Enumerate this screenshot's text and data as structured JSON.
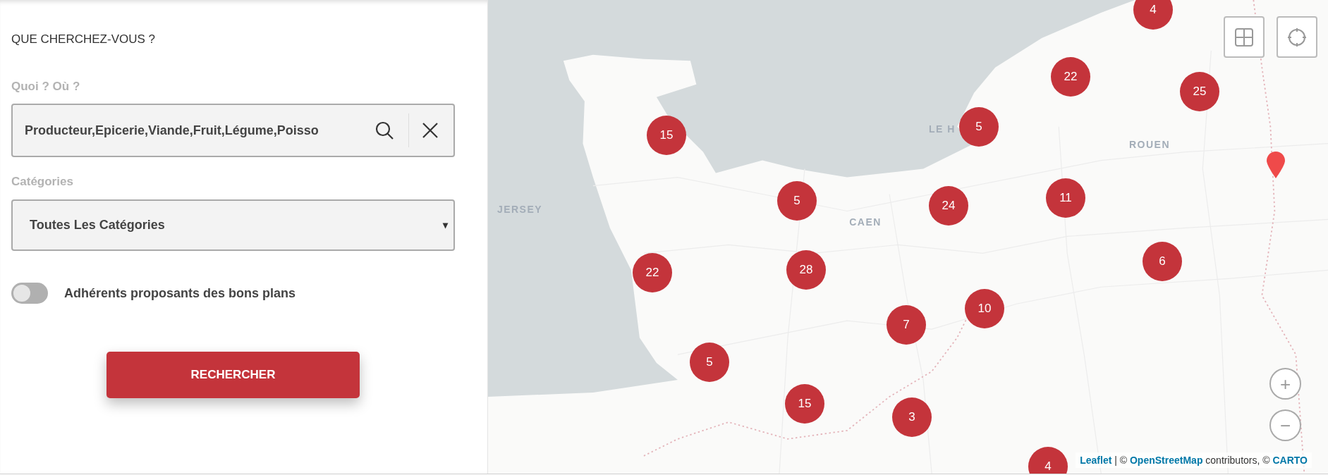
{
  "search_panel": {
    "heading": "QUE CHERCHEZ-VOUS ?",
    "what_where": {
      "label": "Quoi ? Où ?",
      "value": "Producteur,Epicerie,Viande,Fruit,Légume,Poisso"
    },
    "categories": {
      "label": "Catégories",
      "value": "Toutes Les Catégories",
      "caret": "▾"
    },
    "deals_toggle": {
      "label": "Adhérents proposants des bons plans",
      "on": false
    },
    "search_button": "RECHERCHER"
  },
  "map": {
    "place_labels": [
      {
        "text": "JERSEY"
      },
      {
        "text": "CAEN"
      },
      {
        "text": "LE H"
      },
      {
        "text": "ROUEN"
      }
    ],
    "clusters": [
      {
        "count": "4"
      },
      {
        "count": "22"
      },
      {
        "count": "25"
      },
      {
        "count": "15"
      },
      {
        "count": "5"
      },
      {
        "count": "5"
      },
      {
        "count": "24"
      },
      {
        "count": "11"
      },
      {
        "count": "6"
      },
      {
        "count": "22"
      },
      {
        "count": "28"
      },
      {
        "count": "10"
      },
      {
        "count": "7"
      },
      {
        "count": "5"
      },
      {
        "count": "15"
      },
      {
        "count": "3"
      },
      {
        "count": "4"
      }
    ],
    "zoom_in": "+",
    "zoom_out": "−",
    "attribution": [
      {
        "kind": "link",
        "text": "Leaflet"
      },
      {
        "kind": "text",
        "text": " | © "
      },
      {
        "kind": "link",
        "text": "OpenStreetMap"
      },
      {
        "kind": "text",
        "text": " contributors, © "
      },
      {
        "kind": "link",
        "text": "CARTO"
      }
    ]
  }
}
